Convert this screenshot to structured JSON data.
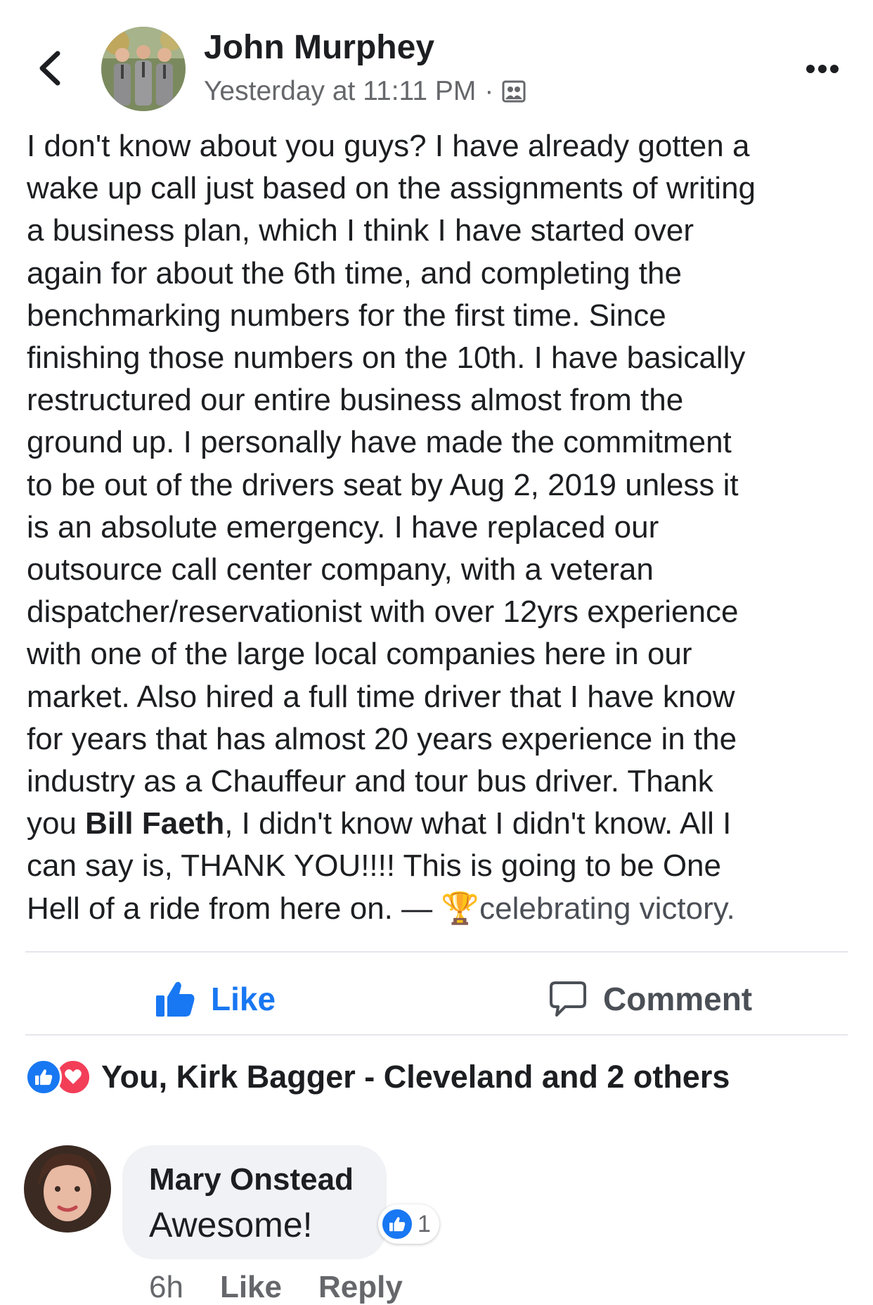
{
  "post": {
    "author": "John Murphey",
    "timestamp": "Yesterday at 11:11 PM",
    "separator": "·",
    "lines": [
      "I don't know about you guys? I have already gotten a",
      "wake up call just based on the assignments of writing",
      "a business plan, which I think I have started over",
      "again for about the 6th time, and completing the",
      "benchmarking numbers for the first time. Since",
      "finishing those numbers on the 10th. I have basically",
      "restructured our entire business almost from the",
      "ground up. I personally have made the commitment",
      "to be out of the drivers seat by Aug 2, 2019 unless it",
      "is an absolute emergency. I have replaced our",
      "outsource call center company, with a veteran",
      "dispatcher/reservationist with over  12yrs experience",
      "with one of the large local companies here in our",
      "market. Also hired a full time driver that I have know",
      "for years that has almost 20 years experience in the",
      "industry as a Chauffeur and tour bus driver. Thank"
    ],
    "line17_pre": "you ",
    "mention": "Bill Faeth",
    "line17_post": ", I didn't know what I didn't know. All I",
    "line18": "can say is, THANK YOU!!!! This is going to be One",
    "line19_pre": "Hell of a ride from here on. — ",
    "activity_emoji": "🏆",
    "activity_text": "celebrating victory."
  },
  "actions": {
    "like_label": "Like",
    "comment_label": "Comment"
  },
  "reactions": {
    "summary": "You, Kirk Bagger - Cleveland and 2 others"
  },
  "comment": {
    "name": "Mary Onstead",
    "text": "Awesome!",
    "reaction_count": "1",
    "time": "6h",
    "like_label": "Like",
    "reply_label": "Reply"
  },
  "icons": {
    "back": "chevron-left-icon",
    "audience": "friends-icon",
    "more": "more-dots-icon",
    "like": "thumbs-up-icon",
    "comment": "speech-bubble-icon",
    "heart": "heart-icon"
  },
  "colors": {
    "accent": "#1877f2",
    "heart": "#f33e58",
    "secondary_text": "#65676b",
    "bubble": "#f0f2f5",
    "divider": "#e4e6eb"
  }
}
